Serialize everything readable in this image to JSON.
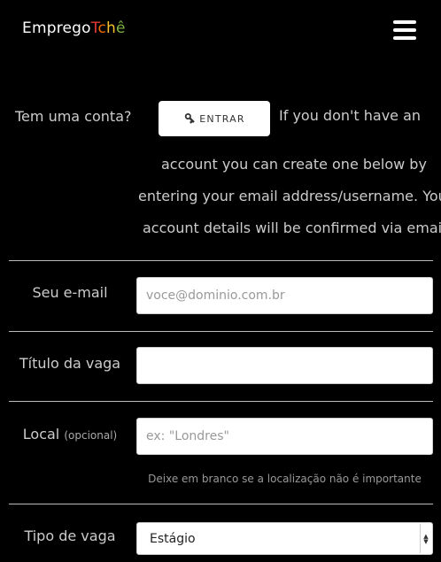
{
  "header": {
    "logo_part1": "Emprego",
    "logo_letters": [
      "T",
      "c",
      "h",
      "ê"
    ],
    "menu_icon": "hamburger-icon"
  },
  "account": {
    "label": "Tem uma conta?",
    "login_label": "ENTRAR",
    "login_icon": "key-icon",
    "message_lines": [
      "If you don't have an",
      "account you can create one below by",
      "entering your email address/username. Your",
      "account details will be confirmed via email."
    ]
  },
  "form": {
    "email": {
      "label": "Seu e-mail",
      "placeholder": "voce@dominio.com.br",
      "value": ""
    },
    "title": {
      "label": "Título da vaga",
      "value": ""
    },
    "location": {
      "label": "Local",
      "optional": "(opcional)",
      "placeholder": "ex: \"Londres\"",
      "hint": "Deixe em branco se a localização não é importante"
    },
    "job_type": {
      "label": "Tipo de vaga",
      "selected": "Estágio"
    }
  },
  "colors": {
    "background": "#000000",
    "logo_t": "#e53935",
    "logo_c": "#ef6c00",
    "logo_h": "#fbc02d",
    "logo_e": "#7cb342"
  }
}
